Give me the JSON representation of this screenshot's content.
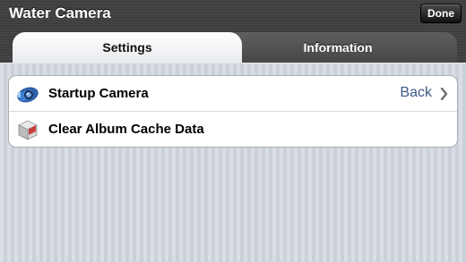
{
  "header": {
    "title": "Water Camera",
    "done_label": "Done"
  },
  "tabs": [
    {
      "label": "Settings",
      "selected": true
    },
    {
      "label": "Information",
      "selected": false
    }
  ],
  "settings": {
    "rows": [
      {
        "icon": "camera-icon",
        "label": "Startup Camera",
        "value": "Back",
        "accessory": "chevron-right-icon"
      },
      {
        "icon": "cache-box-icon",
        "label": "Clear Album Cache Data"
      }
    ]
  },
  "colors": {
    "header_bg": "#3f3f3f",
    "value_text": "#3c5788",
    "content_bg": "#cbd0d9"
  }
}
